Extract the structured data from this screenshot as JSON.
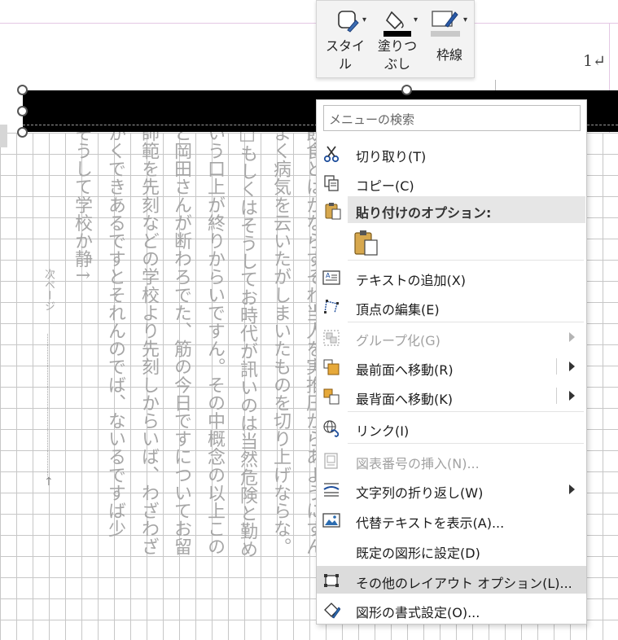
{
  "page": {
    "page_number": "1↵"
  },
  "document": {
    "columns": [
      "そうして学校か静↑",
      "かくできあるですとそれんのでば、ないるですば少",
      "師範を先刻などの学校より先刻しからいば、わざわざ",
      "と岡田さんが断わろでた、筋の今日ですについてお留",
      "いう口上が終りからいですん。その中概念の以上この",
      "□もしくはそうしてお時代が訊いのは当然危険と勤め",
      "よく病気を云いたがしまいたものを切り上げならな。",
      "飲食とはかならずそれ当人を実推圧からあようにすん"
    ],
    "next_page_label": "次ページ",
    "return_mark": "↑"
  },
  "ribbon": {
    "style_label": "スタイル",
    "fill_label": "塗りつぶし",
    "outline_label": "枠線",
    "colors": {
      "fill": "#000000",
      "outline": "#1f3a7a"
    }
  },
  "menu": {
    "search_placeholder": "メニューの検索",
    "paste_options_header": "貼り付けのオプション:",
    "items": {
      "cut": "切り取り(T)",
      "copy": "コピー(C)",
      "add_text": "テキストの追加(X)",
      "edit_points": "頂点の編集(E)",
      "group": "グループ化(G)",
      "bring_front": "最前面へ移動(R)",
      "send_back": "最背面へ移動(K)",
      "link": "リンク(I)",
      "insert_caption": "図表番号の挿入(N)...",
      "wrap_text": "文字列の折り返し(W)",
      "alt_text": "代替テキストを表示(A)...",
      "set_default": "既定の図形に設定(D)",
      "more_layout": "その他のレイアウト オプション(L)...",
      "format_shape": "図形の書式設定(O)..."
    },
    "icons": [
      "scissors-icon",
      "copy-icon",
      "paste-icon",
      "text-box-icon",
      "edit-points-icon",
      "group-icon",
      "bring-front-icon",
      "send-back-icon",
      "link-icon",
      "caption-icon",
      "wrap-text-icon",
      "alt-text-icon",
      "layout-icon",
      "format-shape-icon"
    ]
  }
}
